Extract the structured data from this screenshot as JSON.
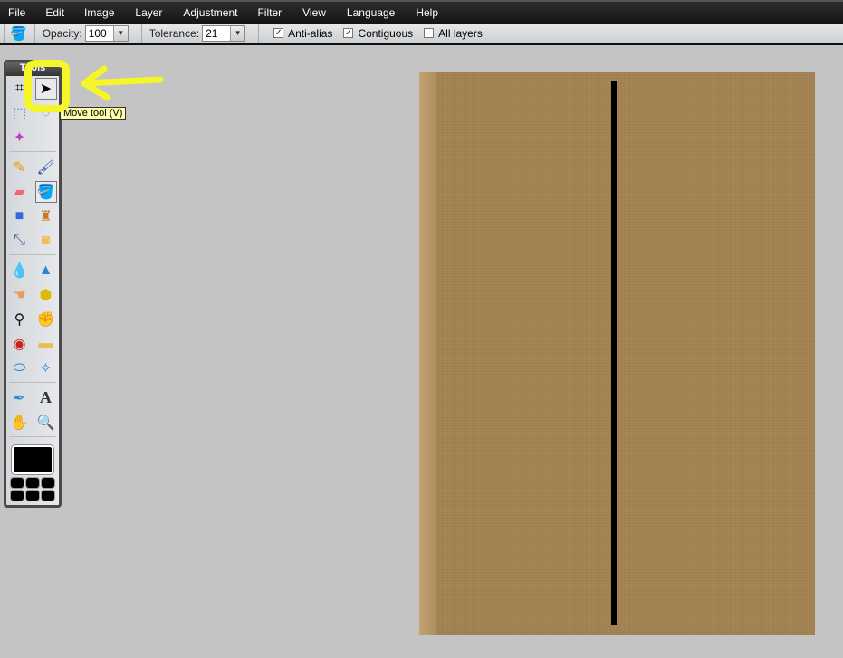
{
  "menu": [
    "File",
    "Edit",
    "Image",
    "Layer",
    "Adjustment",
    "Filter",
    "View",
    "Language",
    "Help"
  ],
  "toolbar": {
    "opacity_label": "Opacity:",
    "opacity_value": "100",
    "tolerance_label": "Tolerance:",
    "tolerance_value": "21",
    "anti_alias": "Anti-alias",
    "anti_alias_checked": true,
    "contiguous": "Contiguous",
    "contiguous_checked": true,
    "all_layers": "All layers",
    "all_layers_checked": false
  },
  "tools": {
    "title": "Tools",
    "tooltip": "Move tool (V)",
    "foreground_color": "#000000",
    "highlight_color": "#f5f52a"
  }
}
